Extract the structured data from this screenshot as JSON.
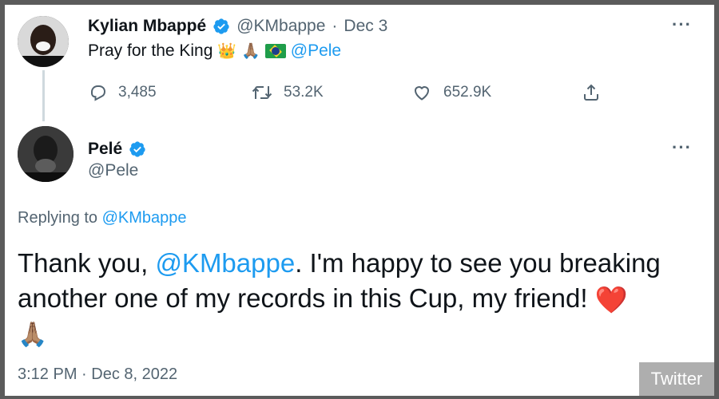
{
  "tweet1": {
    "author_name": "Kylian Mbappé",
    "author_handle": "@KMbappe",
    "separator": "·",
    "date": "Dec 3",
    "text": "Pray for the King",
    "emoji_crown": "👑",
    "emoji_pray": "🙏🏽",
    "mention": "@Pele",
    "actions": {
      "replies": "3,485",
      "retweets": "53.2K",
      "likes": "652.9K"
    }
  },
  "tweet2": {
    "author_name": "Pelé",
    "author_handle": "@Pele",
    "replying_label": "Replying to",
    "replying_to": "@KMbappe",
    "text_part1": "Thank you, ",
    "text_mention": "@KMbappe",
    "text_part2": ". I'm happy to see you breaking another one of my records in this Cup, my friend!",
    "emoji_heart": "❤️",
    "emoji_pray": "🙏🏽",
    "timestamp": "3:12 PM · Dec 8, 2022"
  },
  "more_label": "···",
  "watermark": "Twitter",
  "colors": {
    "link": "#1d9bf0",
    "secondary_text": "#536471",
    "verified": "#1d9bf0",
    "heart": "#f91880"
  }
}
